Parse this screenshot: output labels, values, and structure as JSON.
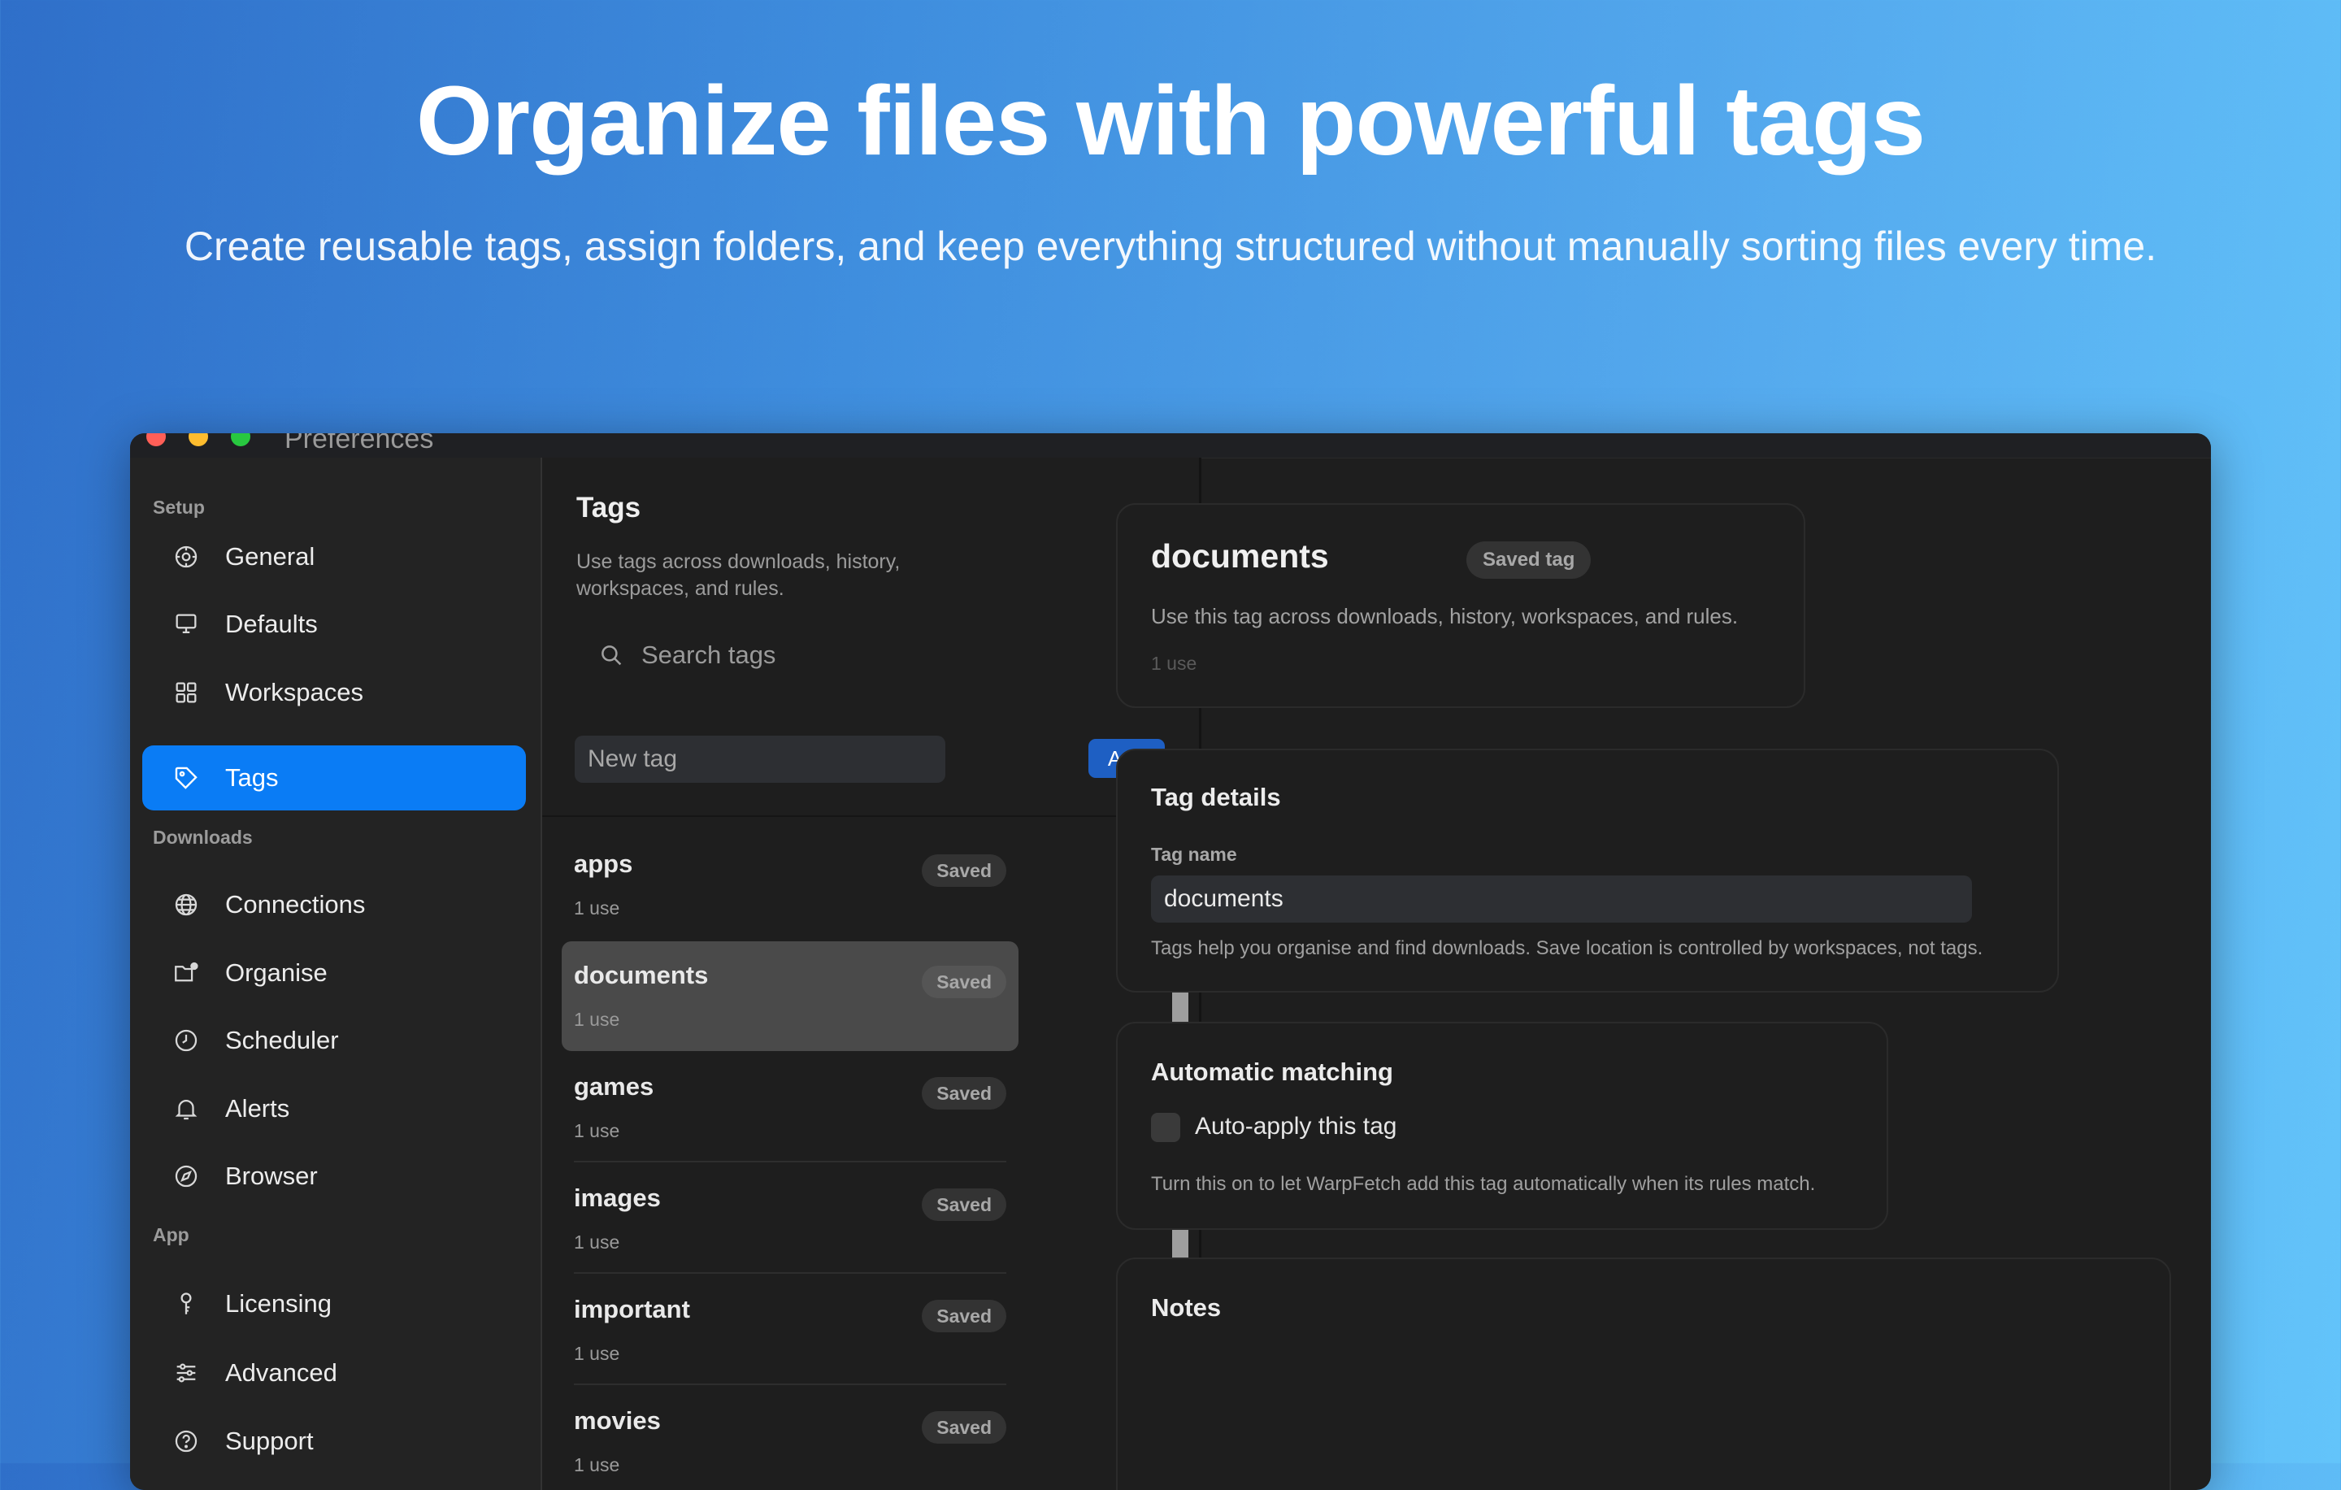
{
  "hero": {
    "title": "Organize files with powerful tags",
    "subtitle": "Create reusable tags, assign folders, and keep everything structured without manually sorting files every time."
  },
  "window": {
    "title": "Preferences"
  },
  "colors": {
    "accent": "#0a7cf5",
    "add_button": "#1e5fc3",
    "background_dark": "#1e1e1e"
  },
  "sidebar": {
    "sections": [
      "Setup",
      "Downloads",
      "App"
    ],
    "items": [
      {
        "label": "General",
        "icon": "gear-icon"
      },
      {
        "label": "Defaults",
        "icon": "monitor-icon"
      },
      {
        "label": "Workspaces",
        "icon": "grid-icon"
      },
      {
        "label": "Tags",
        "icon": "tag-icon",
        "active": true
      },
      {
        "label": "Connections",
        "icon": "globe-icon"
      },
      {
        "label": "Organise",
        "icon": "folder-gear-icon"
      },
      {
        "label": "Scheduler",
        "icon": "clock-icon"
      },
      {
        "label": "Alerts",
        "icon": "bell-icon"
      },
      {
        "label": "Browser",
        "icon": "compass-icon"
      },
      {
        "label": "Licensing",
        "icon": "key-icon"
      },
      {
        "label": "Advanced",
        "icon": "sliders-icon"
      },
      {
        "label": "Support",
        "icon": "question-icon"
      }
    ]
  },
  "tags_panel": {
    "title": "Tags",
    "description": "Use tags across downloads, history, workspaces, and rules.",
    "search_placeholder": "Search tags",
    "new_tag_placeholder": "New tag",
    "add_label": "Add",
    "tags": [
      {
        "name": "apps",
        "uses": "1 use",
        "badge": "Saved"
      },
      {
        "name": "documents",
        "uses": "1 use",
        "badge": "Saved",
        "selected": true
      },
      {
        "name": "games",
        "uses": "1 use",
        "badge": "Saved"
      },
      {
        "name": "images",
        "uses": "1 use",
        "badge": "Saved"
      },
      {
        "name": "important",
        "uses": "1 use",
        "badge": "Saved"
      },
      {
        "name": "movies",
        "uses": "1 use",
        "badge": "Saved"
      }
    ]
  },
  "detail": {
    "header": {
      "name": "documents",
      "badge": "Saved tag",
      "description": "Use this tag across downloads, history, workspaces, and rules.",
      "uses": "1 use"
    },
    "tag_details": {
      "heading": "Tag details",
      "field_label": "Tag name",
      "field_value": "documents",
      "help": "Tags help you organise and find downloads. Save location is controlled by workspaces, not tags."
    },
    "automatic_matching": {
      "heading": "Automatic matching",
      "checkbox_label": "Auto-apply this tag",
      "checked": false,
      "help": "Turn this on to let WarpFetch add this tag automatically when its rules match."
    },
    "notes": {
      "heading": "Notes"
    }
  }
}
